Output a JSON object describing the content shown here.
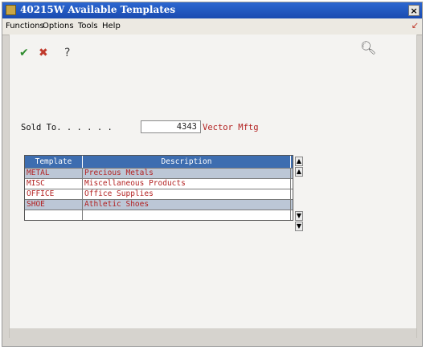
{
  "window": {
    "title": "40215W  Available Templates",
    "close_label": "×"
  },
  "menu": {
    "items": [
      "Functions",
      "Options",
      "Tools",
      "Help"
    ]
  },
  "toolbar": {
    "ok_icon": "check-icon",
    "cancel_icon": "cancel-icon",
    "help_label": "?",
    "search_icon": "search-icon"
  },
  "form": {
    "sold_to_label": "Sold To. . . . . .",
    "sold_to_value": "4343",
    "sold_to_name": "Vector Mftg"
  },
  "grid": {
    "columns": [
      "Template",
      "Description"
    ],
    "rows": [
      {
        "template": "METAL",
        "description": "Precious Metals"
      },
      {
        "template": "MISC",
        "description": "Miscellaneous Products"
      },
      {
        "template": "OFFICE",
        "description": "Office Supplies"
      },
      {
        "template": "SHOE",
        "description": "Athletic Shoes"
      },
      {
        "template": "",
        "description": ""
      }
    ]
  },
  "colors": {
    "title_bar": "#1a4bb0",
    "grid_header": "#3d6db0",
    "text_red": "#b32222",
    "selected_row": "#bcc7d6"
  }
}
